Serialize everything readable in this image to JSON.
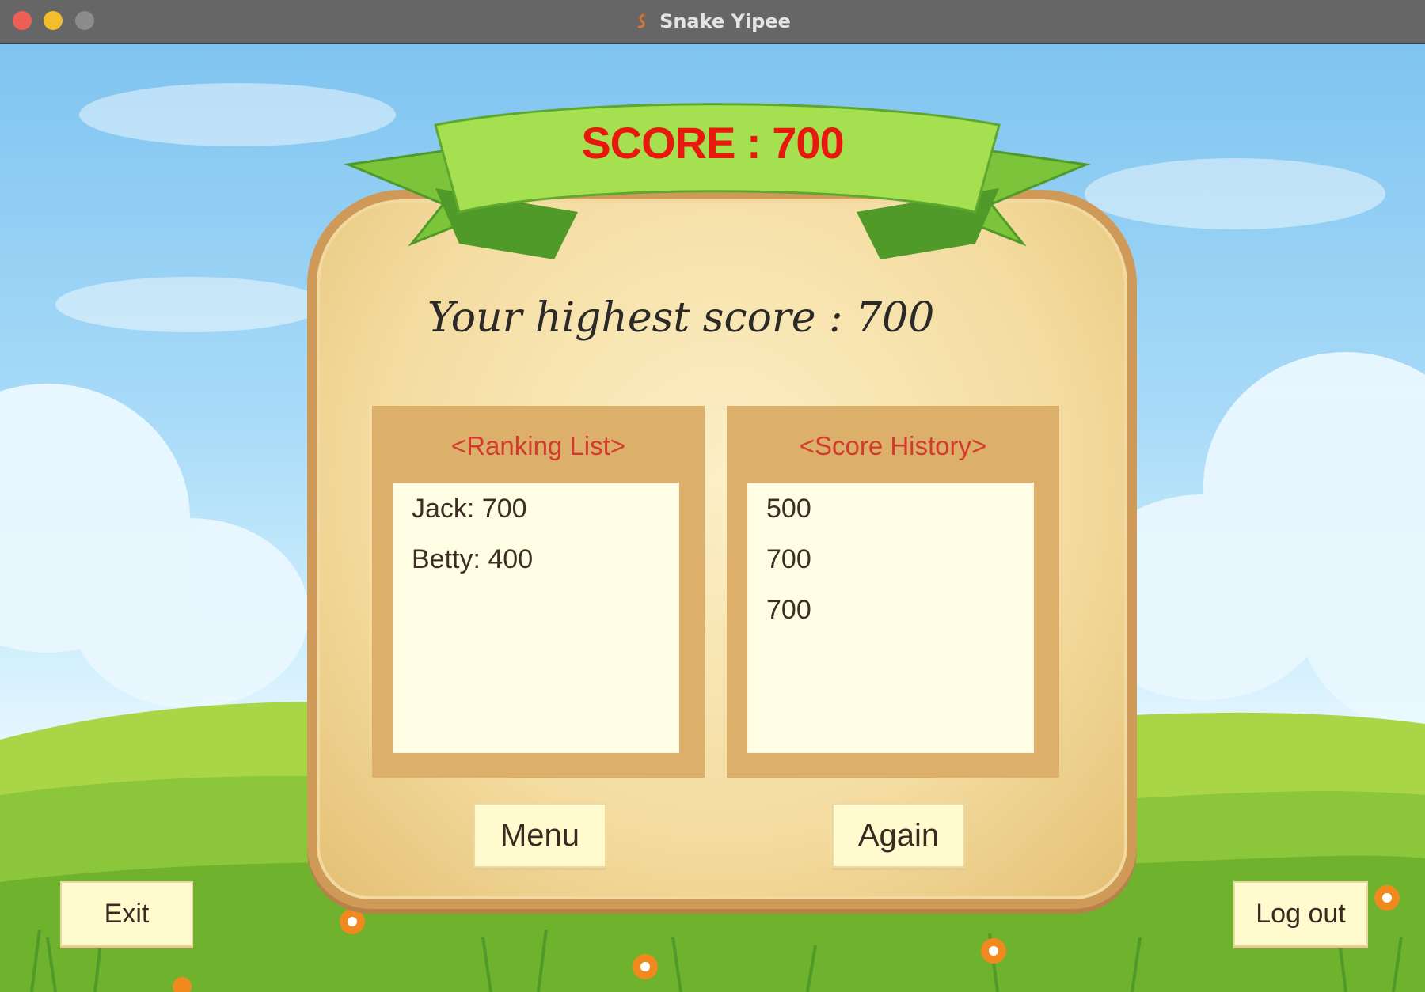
{
  "window": {
    "title": "Snake Yipee"
  },
  "score_banner": {
    "text": "SCORE : 700"
  },
  "highest_score": {
    "text": "Your highest score :  700"
  },
  "ranking": {
    "heading": "<Ranking List>",
    "items": [
      "Jack: 700",
      "Betty: 400"
    ]
  },
  "history": {
    "heading": "<Score History>",
    "items": [
      "500",
      "700",
      "700"
    ]
  },
  "buttons": {
    "menu": "Menu",
    "again": "Again",
    "exit": "Exit",
    "logout": "Log out"
  },
  "colors": {
    "score": "#e9180f",
    "panel_heading": "#d33a2e",
    "ribbon": "#8ed34a"
  }
}
